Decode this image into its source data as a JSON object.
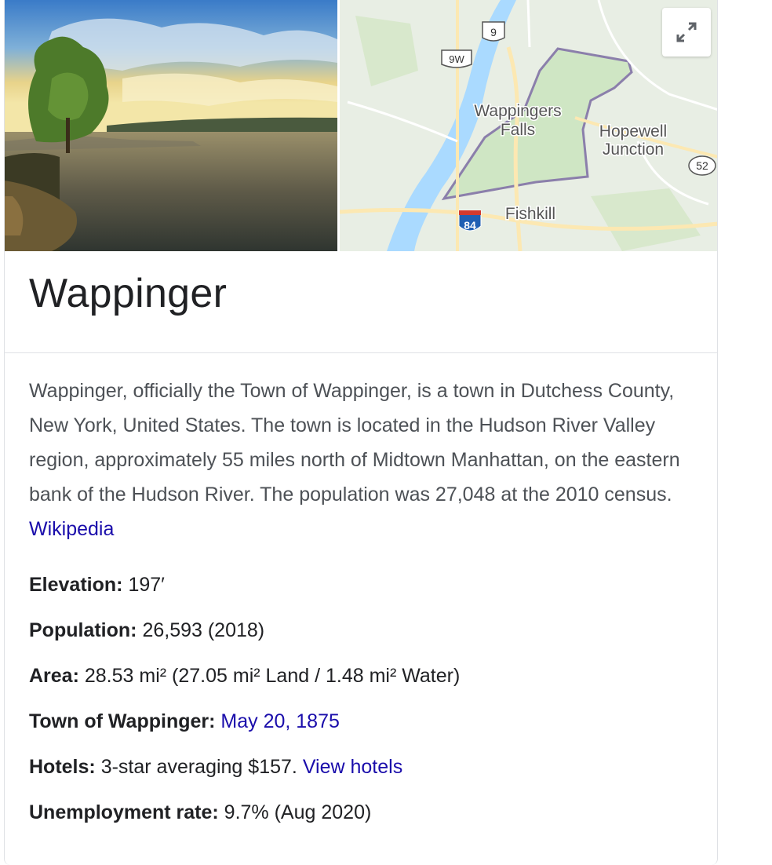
{
  "panel": {
    "title": "Wappinger",
    "description": "Wappinger, officially the Town of Wappinger, is a town in Dutchess County, New York, United States. The town is located in the Hudson River Valley region, approximately 55 miles north of Midtown Manhattan, on the eastern bank of the Hudson River. The population was 27,048 at the 2010 census.",
    "source_link": "Wikipedia",
    "expand_icon": "expand-icon"
  },
  "map": {
    "labels": {
      "wappingers_1": "Wappingers",
      "wappingers_2": "Falls",
      "hopewell_1": "Hopewell",
      "hopewell_2": "Junction",
      "fishkill": "Fishkill"
    },
    "shields": {
      "route_9": "9",
      "route_9w": "9W",
      "route_52": "52",
      "interstate_84": "84"
    }
  },
  "facts": [
    {
      "label": "Elevation:",
      "value": "197′",
      "link": ""
    },
    {
      "label": "Population:",
      "value": "26,593 (2018)",
      "link": ""
    },
    {
      "label": "Area:",
      "value": "28.53 mi² (27.05 mi² Land / 1.48 mi² Water)",
      "link": ""
    },
    {
      "label": "Town of Wappinger:",
      "value": "",
      "link": "May 20, 1875"
    },
    {
      "label": "Hotels:",
      "value": "3-star averaging $157.",
      "link": "View hotels"
    },
    {
      "label": "Unemployment rate:",
      "value": "9.7% (Aug 2020)",
      "link": ""
    }
  ],
  "colors": {
    "link": "#1a0dab",
    "title": "#202124",
    "body_text": "#4d5156",
    "map_land": "#e8eee4",
    "map_area": "#cfe6c4",
    "map_water": "#aadaff",
    "map_road": "#fce8b2",
    "boundary": "#8b7fab"
  }
}
